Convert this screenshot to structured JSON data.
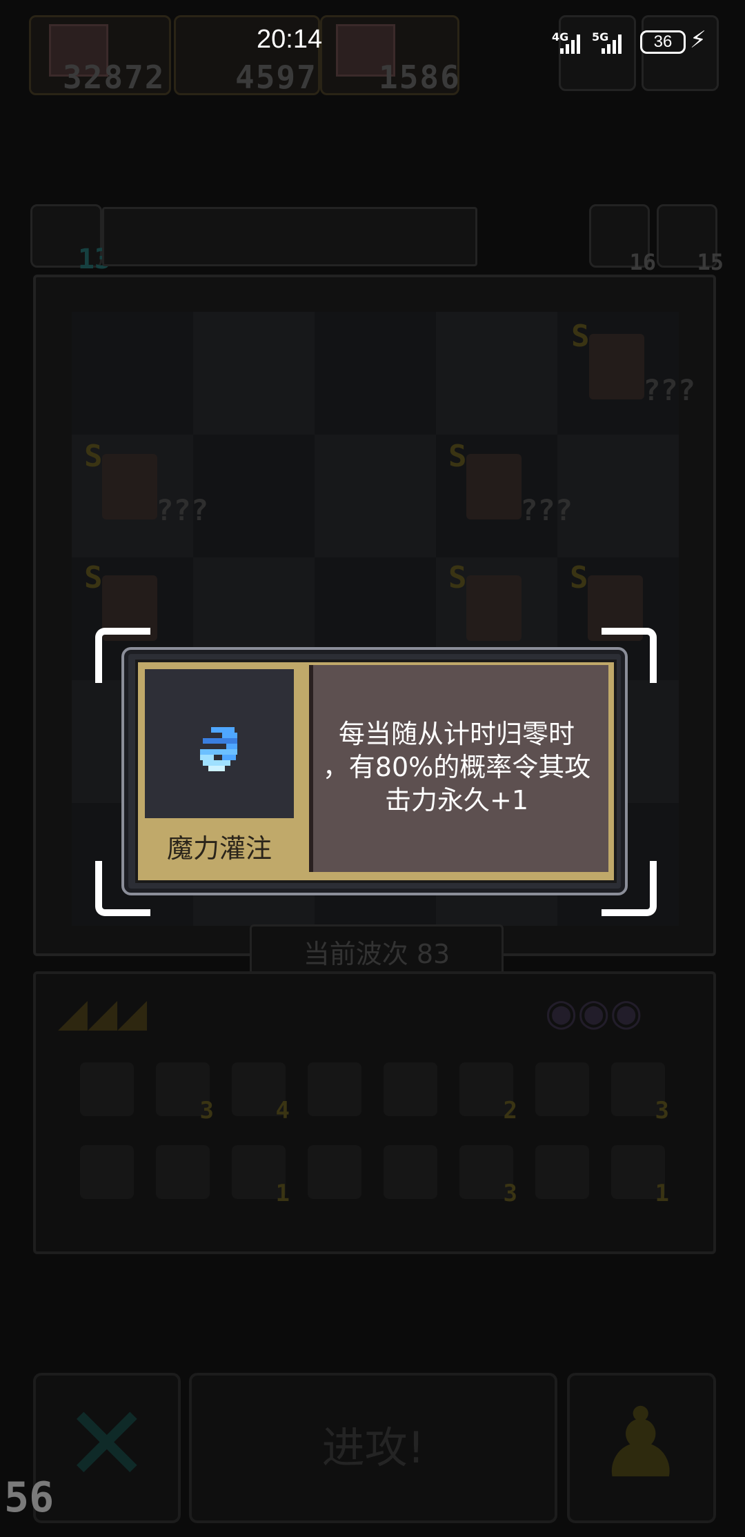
{
  "status_bar": {
    "time": "20:14",
    "network_1": "4G",
    "network_2": "5G",
    "battery": "36"
  },
  "resources": {
    "gold": "32872",
    "hammers": "4597",
    "heroes": "1586"
  },
  "board": {
    "deck_count": "13",
    "counter_a": "16",
    "counter_b": "15",
    "unit_rank": "S",
    "unit_unknown": "???"
  },
  "wave": {
    "label": "当前波次 83"
  },
  "inventory": {
    "counts": [
      "3",
      "4",
      "2",
      "3",
      "1",
      "3",
      "1"
    ]
  },
  "actions": {
    "attack_label": "进攻!"
  },
  "popup": {
    "skill_name": "魔力灌注",
    "description_line1": "每当随从计时归零时",
    "description_line2": "，有80%的概率令其攻",
    "description_line3": "击力永久+1"
  },
  "overlay": {
    "corner_number": "56"
  },
  "colors": {
    "popup_gold": "#c0a96a",
    "popup_desc_bg": "#5d5050",
    "icon_blue": "#4fa7ff"
  }
}
